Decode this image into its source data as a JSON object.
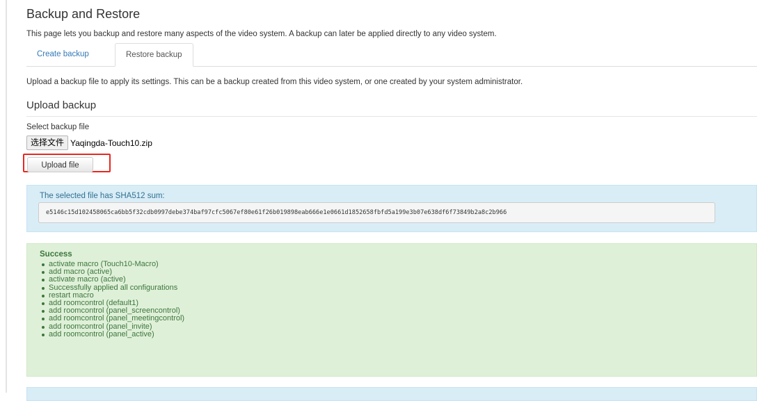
{
  "page": {
    "title": "Backup and Restore",
    "description": "This page lets you backup and restore many aspects of the video system. A backup can later be applied directly to any video system."
  },
  "tabs": [
    {
      "label": "Create backup",
      "active": false
    },
    {
      "label": "Restore backup",
      "active": true
    }
  ],
  "restore": {
    "description": "Upload a backup file to apply its settings. This can be a backup created from this video system, or one created by your system administrator.",
    "section_title": "Upload backup",
    "file_label": "Select backup file",
    "file_button_label": "选择文件",
    "file_name": "Yaqingda-Touch10.zip",
    "upload_button_label": "Upload file"
  },
  "checksum": {
    "label": "The selected file has SHA512 sum:",
    "value": "e5146c15d102458065ca6bb5f32cdb0997debe374baf97cfc5067ef80e61f26b019898eab666e1e0661d1852658fbfd5a199e3b07e638df6f73849b2a8c2b966"
  },
  "result": {
    "title": "Success",
    "items": [
      "activate macro (Touch10-Macro)",
      "add macro (active)",
      "activate macro (active)",
      "Successfully applied all configurations",
      "restart macro",
      "add roomcontrol (default1)",
      "add roomcontrol (panel_screencontrol)",
      "add roomcontrol (panel_meetingcontrol)",
      "add roomcontrol (panel_invite)",
      "add roomcontrol (panel_active)"
    ]
  },
  "colors": {
    "link": "#337ab7",
    "info_background": "#d9edf7",
    "info_text": "#31708f",
    "success_background": "#dff0d8",
    "success_text": "#3c763d",
    "highlight_border": "#e8261f"
  }
}
